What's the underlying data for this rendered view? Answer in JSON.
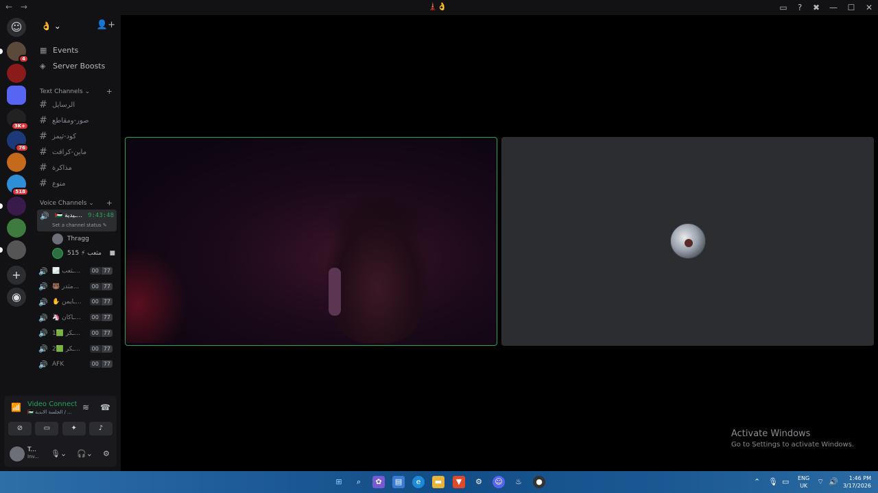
{
  "titlebar": {
    "back": "←",
    "forward": "→",
    "center": "🗼👌",
    "icons": [
      "inbox-icon",
      "help-icon",
      "tools-icon"
    ],
    "window_controls": [
      "—",
      "☐",
      "✕"
    ]
  },
  "servers": [
    {
      "name": "server-1",
      "badge": "4",
      "color": "#5b4a3a"
    },
    {
      "name": "server-2",
      "badge": "",
      "color": "#8b1a1a"
    },
    {
      "name": "server-folder",
      "badge": "",
      "color": "#5865f2"
    },
    {
      "name": "server-4",
      "badge": "3K+",
      "color": "#222"
    },
    {
      "name": "server-5",
      "badge": "76",
      "color": "#1c3a7a"
    },
    {
      "name": "server-6",
      "badge": "",
      "color": "#c46a1a"
    },
    {
      "name": "server-7",
      "badge": "518",
      "color": "#2f8fd6"
    },
    {
      "name": "server-8",
      "badge": "",
      "color": "#3a1a4a"
    },
    {
      "name": "server-9",
      "badge": "",
      "color": "#3f7a3f"
    },
    {
      "name": "server-10",
      "badge": "",
      "color": "#555"
    }
  ],
  "guild": {
    "name": "👌",
    "events": "Events",
    "boosts": "Server Boosts"
  },
  "text_category": "Text Channels",
  "text_channels": [
    "الرسايل",
    "صور-ومقاطع",
    "كود-ثيمز",
    "ماين-كرافت",
    "مذاكرة",
    "منوع"
  ],
  "voice_category": "Voice Channels",
  "active_voice": {
    "name": "🇵🇸 ـيدية...",
    "timer": "9:43:48",
    "status": "Set a channel status"
  },
  "voice_users": [
    {
      "name": "Thragg",
      "extra": ""
    },
    {
      "name": "مثعب ⚡ 515",
      "extra": ""
    }
  ],
  "voice_channels": [
    {
      "name": "🌫️ ـثعب...",
      "a": "00",
      "b": "77"
    },
    {
      "name": "🐻 مثدر...",
      "a": "00",
      "b": "77"
    },
    {
      "name": "✋ ـايمن...",
      "a": "00",
      "b": "77"
    },
    {
      "name": "🦄 ـاكان...",
      "a": "00",
      "b": "77"
    },
    {
      "name": "1🟩 ـكر...",
      "a": "00",
      "b": "77"
    },
    {
      "name": "2🟩 ـكر...",
      "a": "00",
      "b": "77"
    },
    {
      "name": "AFK",
      "a": "00",
      "b": "77"
    }
  ],
  "voice_panel": {
    "title": "Video Connected",
    "subtitle": "🇵🇸 الجلسة الابدية / ...",
    "user_name": "T...",
    "user_status": "Inv..."
  },
  "watermark": {
    "line1": "Activate Windows",
    "line2": "Go to Settings to activate Windows."
  },
  "taskbar": {
    "lang1": "ENG",
    "lang2": "UK",
    "time": "1:46 PM",
    "date": "3/17/2026"
  }
}
